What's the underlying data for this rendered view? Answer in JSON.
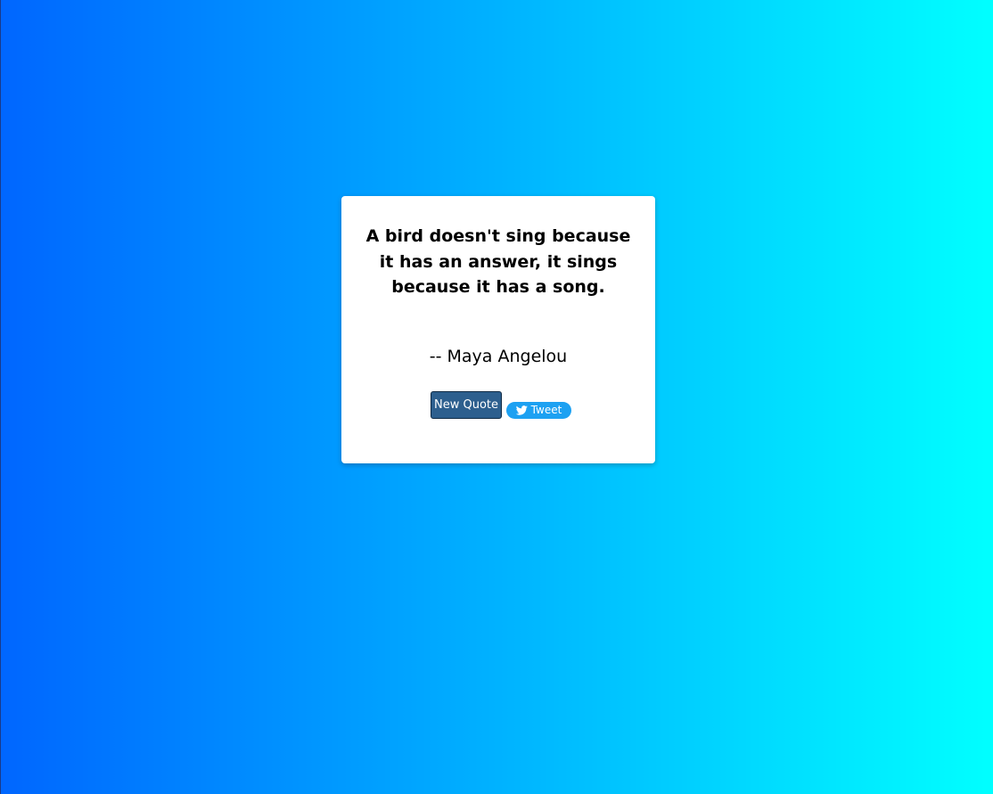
{
  "quote": {
    "text": "A bird doesn't sing because it has an answer, it sings because it has a song.",
    "author": "-- Maya Angelou"
  },
  "buttons": {
    "new_quote_label": "New Quote",
    "tweet_label": "Tweet"
  },
  "icons": {
    "tweet": "twitter-bird-icon"
  },
  "colors": {
    "gradient_start": "#0066ff",
    "gradient_end": "#00ffff",
    "card_background": "#ffffff",
    "new_quote_button": "#2d5f8e",
    "tweet_button": "#1da1f2"
  }
}
